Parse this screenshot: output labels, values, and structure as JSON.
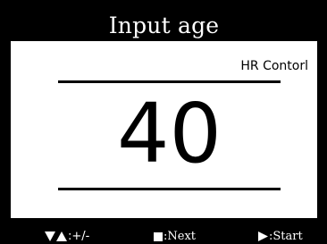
{
  "screen": {
    "title": "Input age",
    "mode_label": "HR Contorl",
    "value": "40"
  },
  "softkeys": {
    "adjust": {
      "label": ":+/-",
      "icons": [
        "triangle-down-icon",
        "triangle-up-icon"
      ]
    },
    "next": {
      "label": ":Next",
      "icon": "square-icon"
    },
    "start": {
      "label": ":Start",
      "icon": "triangle-right-icon"
    }
  },
  "colors": {
    "background": "#000000",
    "panel": "#ffffff",
    "text_on_dark": "#ffffff",
    "text_on_light": "#000000"
  }
}
